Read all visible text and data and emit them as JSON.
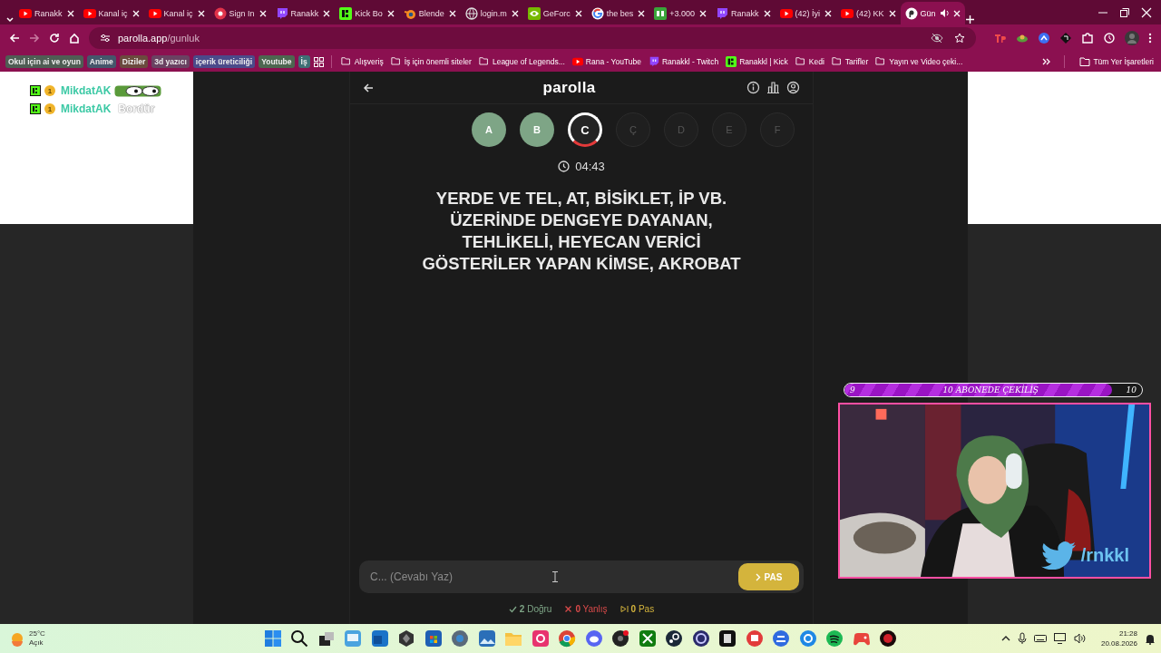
{
  "browser": {
    "tabs": [
      {
        "title": "Ranakk",
        "selected": false,
        "audio": false
      },
      {
        "title": "Kanal iç",
        "selected": false,
        "audio": false
      },
      {
        "title": "Kanal iç",
        "selected": false,
        "audio": false
      },
      {
        "title": "Sign In",
        "selected": false,
        "audio": false
      },
      {
        "title": "Ranakk",
        "selected": false,
        "audio": false
      },
      {
        "title": "Kick Bo",
        "selected": false,
        "audio": false
      },
      {
        "title": "Blende",
        "selected": false,
        "audio": false
      },
      {
        "title": "login.m",
        "selected": false,
        "audio": false
      },
      {
        "title": "GeForc",
        "selected": false,
        "audio": false
      },
      {
        "title": "the bes",
        "selected": false,
        "audio": false
      },
      {
        "title": "+3.000",
        "selected": false,
        "audio": false
      },
      {
        "title": "Ranakk",
        "selected": false,
        "audio": false
      },
      {
        "title": "(42) İyi",
        "selected": false,
        "audio": false
      },
      {
        "title": "(42) KK",
        "selected": false,
        "audio": false
      },
      {
        "title": "Gün",
        "selected": true,
        "audio": true
      }
    ],
    "address": {
      "domain": "parolla.app",
      "path": "/gunluk"
    },
    "bookmark_groups": [
      {
        "label": "Okul için ai ve oyun",
        "color": "#4f5d54"
      },
      {
        "label": "Anime",
        "color": "#45566b"
      },
      {
        "label": "Diziler",
        "color": "#6b4a3e"
      },
      {
        "label": "3d yazıcı",
        "color": "#6a4262"
      },
      {
        "label": "içerik üreticiliği",
        "color": "#4b4a8a"
      },
      {
        "label": "Youtube",
        "color": "#4d6650"
      },
      {
        "label": "İş",
        "color": "#3f6f75"
      }
    ],
    "bookmarks": [
      {
        "label": "Alışveriş",
        "kind": "folder"
      },
      {
        "label": "İş için önemli siteler",
        "kind": "folder"
      },
      {
        "label": "League of Legends...",
        "kind": "folder"
      },
      {
        "label": "Rana - YouTube",
        "kind": "link"
      },
      {
        "label": "Ranakkl - Twitch",
        "kind": "link"
      },
      {
        "label": "Ranakkl | Kick",
        "kind": "link"
      },
      {
        "label": "Kedi",
        "kind": "folder"
      },
      {
        "label": "Tarifler",
        "kind": "folder"
      },
      {
        "label": "Yayın ve Video çeki...",
        "kind": "folder"
      }
    ],
    "all_bookmarks": "Tüm Yer İşaretleri"
  },
  "chat": [
    {
      "badge": "1",
      "user": "MikdatAK",
      "kind": "emote"
    },
    {
      "badge": "1",
      "user": "MikdatAK",
      "kind": "text",
      "message": "Bordür"
    }
  ],
  "game": {
    "title": "parolla",
    "letters": [
      {
        "letter": "A",
        "kind": "correct"
      },
      {
        "letter": "B",
        "kind": "correct"
      },
      {
        "letter": "C",
        "kind": "current"
      },
      {
        "letter": "Ç",
        "kind": "pending"
      },
      {
        "letter": "D",
        "kind": "pending"
      },
      {
        "letter": "E",
        "kind": "pending"
      },
      {
        "letter": "F",
        "kind": "pending"
      }
    ],
    "timer": "04:43",
    "question": "YERDE VE TEL, AT, BİSİKLET, İP VB.\nÜZERİNDE DENGEYE DAYANAN,\nTEHLİKELİ, HEYECAN VERİCİ\nGÖSTERİLER YAPAN KİMSE, AKROBAT",
    "answer": {
      "placeholder": "C... (Cevabı Yaz)"
    },
    "pass_button": "PAS",
    "stats": [
      {
        "kind": "correct",
        "count": "2",
        "label": "Doğru"
      },
      {
        "kind": "wrong",
        "count": "0",
        "label": "Yanlış"
      },
      {
        "kind": "pass",
        "count": "0",
        "label": "Pas"
      }
    ]
  },
  "stream_overlay": {
    "goal": {
      "current": "9",
      "title": "10 ABONEDE ÇEKİLİŞ",
      "target": "10",
      "level": 0.9
    },
    "social": "/rnkkl"
  },
  "taskbar": {
    "weather": {
      "temperature": "25°C",
      "condition": "Açık"
    },
    "clock": {
      "time": "21:28",
      "date": "20.08.2026"
    }
  }
}
